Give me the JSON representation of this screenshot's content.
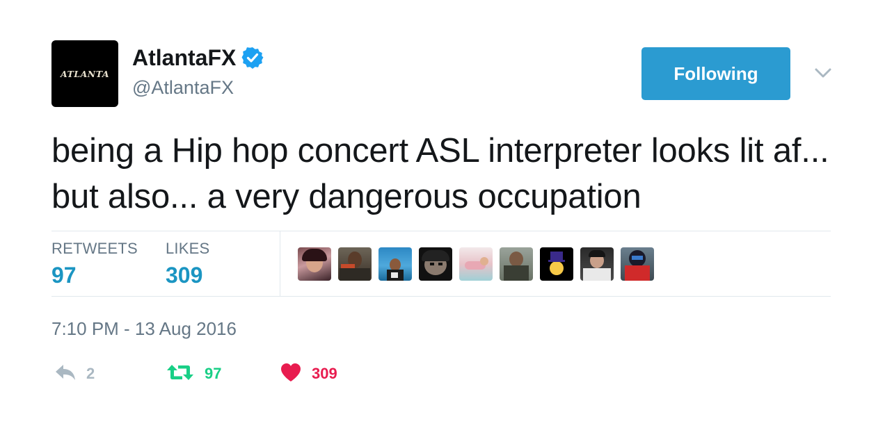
{
  "tweet": {
    "avatar_text": "ATLANTA",
    "display_name": "AtlantaFX",
    "verified_icon": "verified-badge-icon",
    "handle": "@AtlantaFX",
    "follow_label": "Following",
    "text": "being a Hip hop concert ASL interpreter looks lit af... but also... a very dangerous occupation",
    "timestamp": "7:10 PM - 13 Aug 2016"
  },
  "stats": {
    "retweets_label": "RETWEETS",
    "retweets_value": "97",
    "likes_label": "LIKES",
    "likes_value": "309"
  },
  "actions": {
    "reply_count": "2",
    "retweet_count": "97",
    "like_count": "309"
  },
  "colors": {
    "follow_bg": "#2b9bd1",
    "stat_value": "#1b95c2",
    "retweet_active": "#19cf86",
    "like_active": "#e81c4f",
    "muted": "#657786",
    "verified": "#1da1f2"
  }
}
